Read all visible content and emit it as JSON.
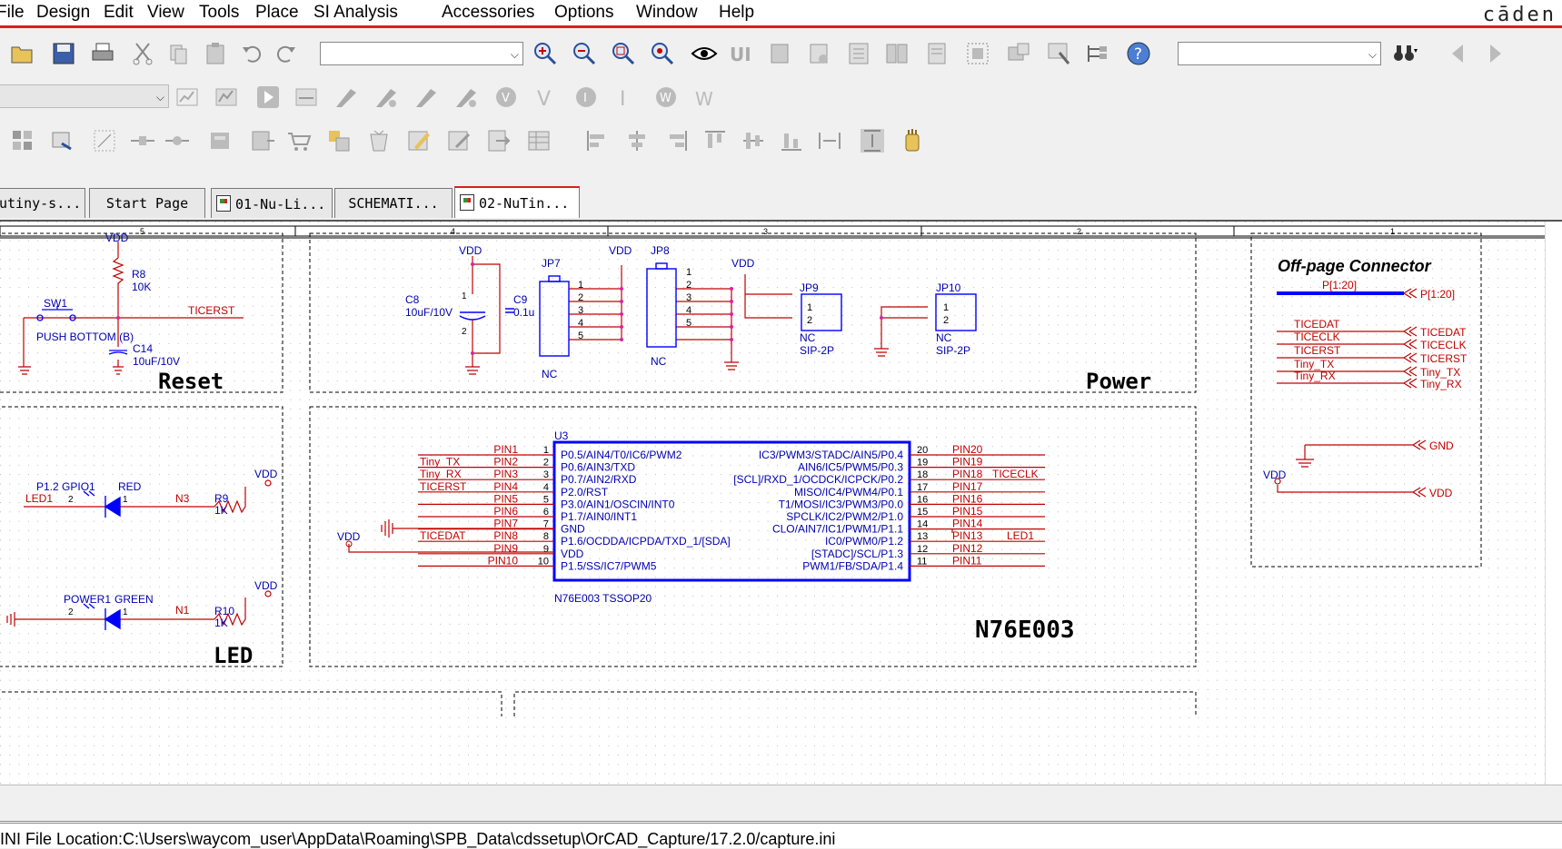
{
  "menu": [
    "File",
    "Design",
    "Edit",
    "View",
    "Tools",
    "Place",
    "SI Analysis",
    "Accessories",
    "Options",
    "Window",
    "Help"
  ],
  "brand": "cāden",
  "toolbar": {
    "row1_icons": [
      "open-icon",
      "save-icon",
      "print-icon",
      "cut-icon",
      "copy-icon",
      "paste-icon",
      "undo-icon",
      "redo-icon",
      "zoom-in-icon",
      "zoom-out-icon",
      "zoom-area-icon",
      "zoom-all-icon",
      "eye-icon",
      "help-icon",
      "binoculars-icon"
    ],
    "row2_icons": [
      "simulate-icon",
      "run-icon",
      "probe-icon",
      "voltage-marker-icon",
      "current-marker-icon"
    ],
    "row3_icons": [
      "netlist-icon",
      "bom-icon",
      "drc-icon",
      "align-left-icon",
      "align-center-icon",
      "align-right-icon"
    ]
  },
  "tabs": [
    {
      "label": "utiny-s..."
    },
    {
      "label": "Start Page"
    },
    {
      "label": "01-Nu-Li..."
    },
    {
      "label": "SCHEMATI..."
    },
    {
      "label": "02-NuTin..."
    }
  ],
  "border": {
    "cols": [
      "5",
      "4",
      "3",
      "2",
      "1"
    ]
  },
  "schematic": {
    "reset": {
      "title": "Reset",
      "vdd": "VDD",
      "r8": "R8",
      "r8v": "10K",
      "sw": "SW1",
      "net": "TICERST",
      "push": "PUSH BOTTOM (B)",
      "c14": "C14",
      "c14v": "10uF/10V"
    },
    "power": {
      "title": "Power",
      "vdd": "VDD",
      "jp7": "JP7",
      "jp8": "JP8",
      "jp9": "JP9",
      "jp10": "JP10",
      "c8": "C8",
      "c8v": "10uF/10V",
      "c9": "C9",
      "c9v": "0.1u",
      "nc": "NC",
      "sip": "SIP-2P",
      "pins5": [
        "1",
        "2",
        "3",
        "4",
        "5"
      ],
      "pins2": [
        "1",
        "2"
      ],
      "c_pins": [
        "1",
        "2"
      ]
    },
    "opc": {
      "title": "Off-page Connector",
      "bus_label": "P[1:20]",
      "bus_conn": "P[1:20]",
      "nets": [
        "TICEDAT",
        "TICECLK",
        "TICERST",
        "Tiny_TX",
        "Tiny_RX"
      ],
      "gnd": "GND",
      "vdd": "VDD"
    },
    "led": {
      "title": "LED",
      "vdd": "VDD",
      "d1_ref": "P1.2 GPIO1",
      "d1_color": "RED",
      "d1_net": "LED1",
      "n3": "N3",
      "r9": "R9",
      "r9v": "1K",
      "d2_ref": "POWER1",
      "d2_color": "GREEN",
      "n1": "N1",
      "r10": "R10",
      "r10v": "1K",
      "pin2": "2",
      "pin1": "1"
    },
    "mcu": {
      "title": "N76E003",
      "ref": "U3",
      "part": "N76E003 TSSOP20",
      "vdd": "VDD",
      "left_pins": [
        {
          "num": "1",
          "net": "PIN1",
          "sig": "",
          "fn": "P0.5/AIN4/T0/IC6/PWM2"
        },
        {
          "num": "2",
          "net": "PIN2",
          "sig": "Tiny_TX",
          "fn": "P0.6/AIN3/TXD"
        },
        {
          "num": "3",
          "net": "PIN3",
          "sig": "Tiny_RX",
          "fn": "P0.7/AIN2/RXD"
        },
        {
          "num": "4",
          "net": "PIN4",
          "sig": "TICERST",
          "fn": "P2.0/RST"
        },
        {
          "num": "5",
          "net": "PIN5",
          "sig": "",
          "fn": "P3.0/AIN1/OSCIN/INT0"
        },
        {
          "num": "6",
          "net": "PIN6",
          "sig": "",
          "fn": "P1.7/AIN0/INT1"
        },
        {
          "num": "7",
          "net": "PIN7",
          "sig": "",
          "fn": "GND"
        },
        {
          "num": "8",
          "net": "PIN8",
          "sig": "TICEDAT",
          "fn": "P1.6/OCDDA/ICPDA/TXD_1/[SDA]"
        },
        {
          "num": "9",
          "net": "PIN9",
          "sig": "",
          "fn": "VDD"
        },
        {
          "num": "10",
          "net": "PIN10",
          "sig": "",
          "fn": "P1.5/SS/IC7/PWM5"
        }
      ],
      "right_pins": [
        {
          "num": "20",
          "net": "PIN20",
          "sig": "",
          "fn": "IC3/PWM3/STADC/AIN5/P0.4"
        },
        {
          "num": "19",
          "net": "PIN19",
          "sig": "",
          "fn": "AIN6/IC5/PWM5/P0.3"
        },
        {
          "num": "18",
          "net": "PIN18",
          "sig": "TICECLK",
          "fn": "[SCL]/RXD_1/OCDCK/ICPCK/P0.2"
        },
        {
          "num": "17",
          "net": "PIN17",
          "sig": "",
          "fn": "MISO/IC4/PWM4/P0.1"
        },
        {
          "num": "16",
          "net": "PIN16",
          "sig": "",
          "fn": "T1/MOSI/IC3/PWM3/P0.0"
        },
        {
          "num": "15",
          "net": "PIN15",
          "sig": "",
          "fn": "SPCLK/IC2/PWM2/P1.0"
        },
        {
          "num": "14",
          "net": "PIN14",
          "sig": "",
          "fn": "CLO/AIN7/IC1/PWM1/P1.1"
        },
        {
          "num": "13",
          "net": "PIN13",
          "sig": "LED1",
          "fn": "IC0/PWM0/P1.2"
        },
        {
          "num": "12",
          "net": "PIN12",
          "sig": "",
          "fn": "[STADC]/SCL/P1.3"
        },
        {
          "num": "11",
          "net": "PIN11",
          "sig": "",
          "fn": "PWM1/FB/SDA/P1.4"
        }
      ]
    }
  },
  "status": {
    "path": "INI File Location:C:\\Users\\waycom_user\\AppData\\Roaming\\SPB_Data\\cdssetup\\OrCAD_Capture/17.2.0/capture.ini"
  },
  "colors": {
    "accent": "#d81e1e",
    "wire": "#d81e1e",
    "part": "#0000ff",
    "pin": "#c00000",
    "text": "#0000b0",
    "junction": "#e020a0"
  }
}
